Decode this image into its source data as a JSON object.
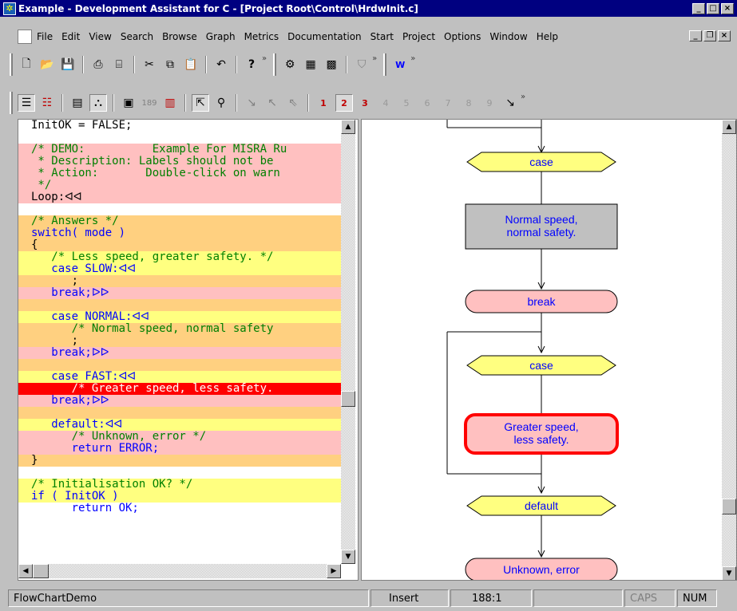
{
  "window": {
    "title": "Example - Development Assistant for C - [Project Root\\Control\\HrdwInit.c]"
  },
  "menu": [
    "File",
    "Edit",
    "View",
    "Search",
    "Browse",
    "Graph",
    "Metrics",
    "Documentation",
    "Start",
    "Project",
    "Options",
    "Window",
    "Help"
  ],
  "code_lines": [
    {
      "text": "InitOK = FALSE;",
      "bg": "#ffffff",
      "color": "#000000"
    },
    {
      "text": "",
      "bg": "#ffffff",
      "color": "#000000"
    },
    {
      "text": "/* DEMO:          Example For MISRA Ru",
      "bg": "#ffc0c0",
      "color": "#008000"
    },
    {
      "text": " * Description: Labels should not be",
      "bg": "#ffc0c0",
      "color": "#008000"
    },
    {
      "text": " * Action:       Double-click on warn",
      "bg": "#ffc0c0",
      "color": "#008000"
    },
    {
      "text": " */",
      "bg": "#ffc0c0",
      "color": "#008000"
    },
    {
      "text": "Loop:ᐊᐊ",
      "bg": "#ffc0c0",
      "color": "#000000"
    },
    {
      "text": "",
      "bg": "#ffffff",
      "color": "#000000"
    },
    {
      "text": "/* Answers */",
      "bg": "#ffd080",
      "color": "#008000"
    },
    {
      "text": "switch( mode )",
      "bg": "#ffd080",
      "color": "#0000ff"
    },
    {
      "text": "{",
      "bg": "#ffd080",
      "color": "#000000"
    },
    {
      "text": "   /* Less speed, greater safety. */",
      "bg": "#ffff80",
      "color": "#008000"
    },
    {
      "text": "   case SLOW:ᐊᐊ",
      "bg": "#ffff80",
      "color": "#0000ff"
    },
    {
      "text": "      ;",
      "bg": "#ffd080",
      "color": "#000000"
    },
    {
      "text": "   break;ᐅᐅ",
      "bg": "#ffc0c0",
      "color": "#0000ff"
    },
    {
      "text": "",
      "bg": "#ffd080",
      "color": "#000000"
    },
    {
      "text": "   case NORMAL:ᐊᐊ",
      "bg": "#ffff80",
      "color": "#0000ff"
    },
    {
      "text": "      /* Normal speed, normal safety",
      "bg": "#ffd080",
      "color": "#008000"
    },
    {
      "text": "      ;",
      "bg": "#ffd080",
      "color": "#000000"
    },
    {
      "text": "   break;ᐅᐅ",
      "bg": "#ffc0c0",
      "color": "#0000ff"
    },
    {
      "text": "",
      "bg": "#ffd080",
      "color": "#000000"
    },
    {
      "text": "   case FAST:ᐊᐊ",
      "bg": "#ffff80",
      "color": "#0000ff"
    },
    {
      "text": "      /* Greater speed, less safety.",
      "bg": "#ff0000",
      "color": "#ffffff"
    },
    {
      "text": "   break;ᐅᐅ",
      "bg": "#ffc0c0",
      "color": "#0000ff"
    },
    {
      "text": "",
      "bg": "#ffd080",
      "color": "#000000"
    },
    {
      "text": "   default:ᐊᐊ",
      "bg": "#ffff80",
      "color": "#0000ff"
    },
    {
      "text": "      /* Unknown, error */",
      "bg": "#ffc0c0",
      "color": "#008000"
    },
    {
      "text": "      return ERROR;",
      "bg": "#ffc0c0",
      "color": "#0000ff"
    },
    {
      "text": "}",
      "bg": "#ffd080",
      "color": "#000000"
    },
    {
      "text": "",
      "bg": "#ffffff",
      "color": "#000000"
    },
    {
      "text": "/* Initialisation OK? */",
      "bg": "#ffff80",
      "color": "#008000"
    },
    {
      "text": "if ( InitOK )",
      "bg": "#ffff80",
      "color": "#0000ff"
    },
    {
      "text": "      return OK;",
      "bg": "#ffffff",
      "color": "#0000ff"
    }
  ],
  "flow_nodes": [
    {
      "kind": "hex",
      "label": "case"
    },
    {
      "kind": "rect",
      "label": "Normal speed, normal safety."
    },
    {
      "kind": "pill",
      "label": "break"
    },
    {
      "kind": "hex",
      "label": "case"
    },
    {
      "kind": "pill-hl",
      "label": "Greater speed, less safety."
    },
    {
      "kind": "hex",
      "label": "default"
    },
    {
      "kind": "pill",
      "label": "Unknown, error"
    }
  ],
  "status": {
    "name": "FlowChartDemo",
    "mode": "Insert",
    "pos": "188:1",
    "caps": "CAPS",
    "num": "NUM"
  }
}
